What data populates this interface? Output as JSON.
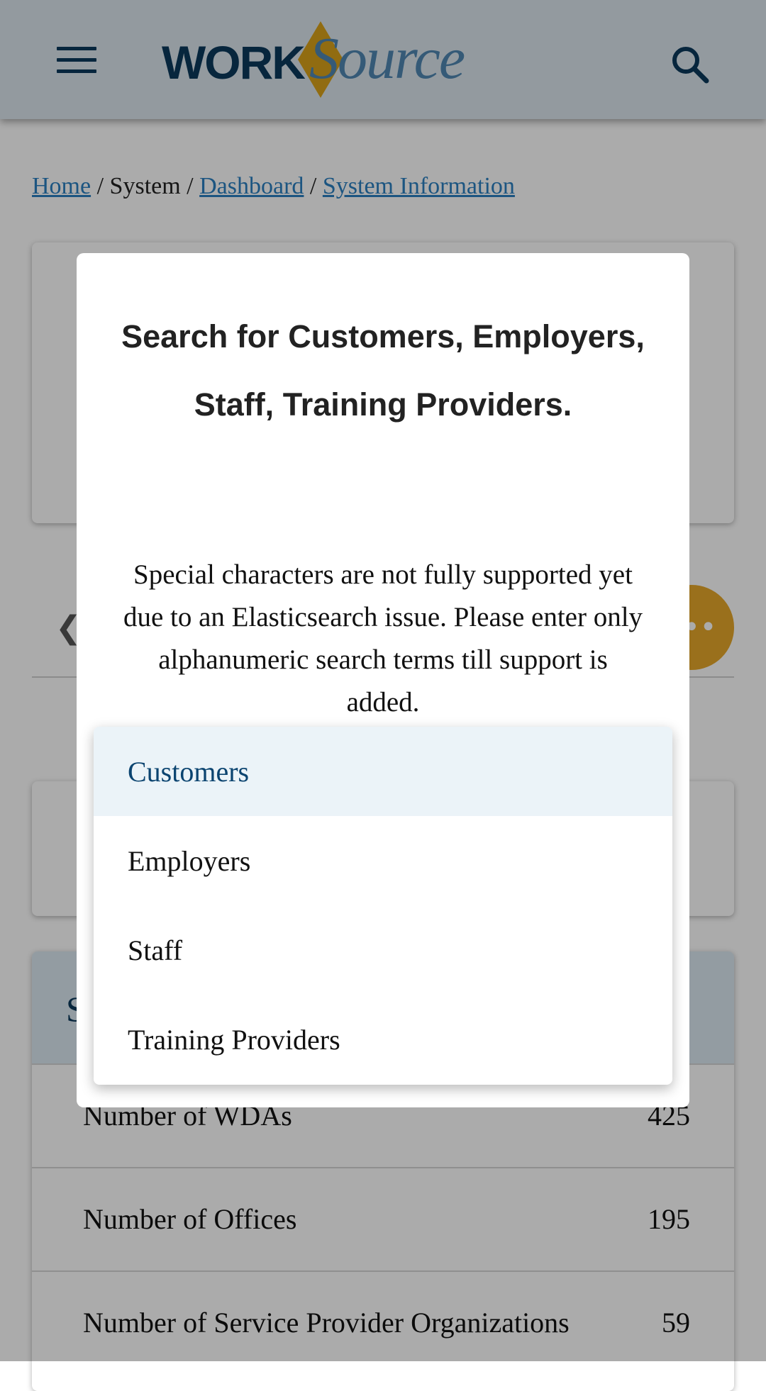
{
  "header": {
    "menu_icon": "hamburger-menu-icon",
    "logo": {
      "part1": "WORK",
      "part2": "Source"
    },
    "search_icon": "search-icon",
    "colors": {
      "navy": "#0b3a5c",
      "blue": "#4f86b2",
      "gold": "#d9a21a"
    }
  },
  "breadcrumb": {
    "items": [
      {
        "label": "Home",
        "link": true
      },
      {
        "label": "System",
        "link": false
      },
      {
        "label": "Dashboard",
        "link": true
      },
      {
        "label": "System Information",
        "link": true
      }
    ],
    "separator": "/"
  },
  "background": {
    "pager_prev_icon": "chevron-left-icon",
    "fab_icon": "more-icon",
    "stats_heading_partial": "S",
    "rows": [
      {
        "label": "Number of WDAs",
        "value": "425"
      },
      {
        "label": "Number of Offices",
        "value": "195"
      },
      {
        "label": "Number of Service Provider Organizations",
        "value": "59"
      }
    ]
  },
  "modal": {
    "title": "Search for Customers, Employers, Staff, Training Providers.",
    "notice": "Special characters are not fully supported yet due to an Elasticsearch issue. Please enter only alphanumeric search terms till support is added.",
    "dropdown": {
      "selected": "Customers",
      "options": [
        "Customers",
        "Employers",
        "Staff",
        "Training Providers"
      ]
    }
  }
}
